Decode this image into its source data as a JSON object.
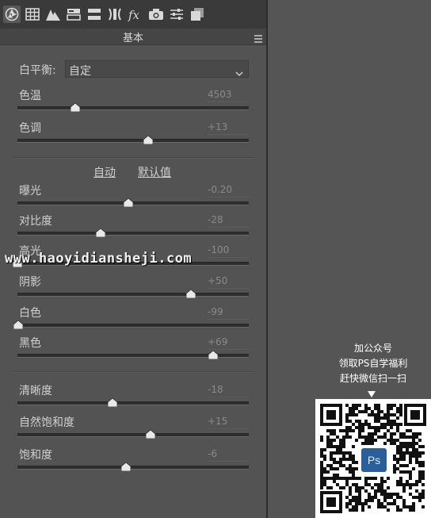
{
  "toolbar": {
    "icons": [
      "aperture-icon",
      "grid-icon",
      "mountain-icon",
      "split-tone-icon",
      "hsl-bars-icon",
      "lens-icon",
      "fx-icon",
      "camera-icon",
      "sliders-icon",
      "layers-icon"
    ]
  },
  "section": {
    "title": "基本"
  },
  "white_balance": {
    "label": "白平衡:",
    "value": "自定"
  },
  "temp_tint": [
    {
      "id": "temperature",
      "label": "色温",
      "value": "4503",
      "level": 0.25
    },
    {
      "id": "tint",
      "label": "色调",
      "value": "+13",
      "level": 0.565
    }
  ],
  "links": {
    "auto": "自动",
    "default": "默认值"
  },
  "tone": [
    {
      "id": "exposure",
      "label": "曝光",
      "value": "-0.20",
      "level": 0.48
    },
    {
      "id": "contrast",
      "label": "对比度",
      "value": "-28",
      "level": 0.36
    },
    {
      "id": "highlights",
      "label": "高光",
      "value": "-100",
      "level": 0.0
    },
    {
      "id": "shadows",
      "label": "阴影",
      "value": "+50",
      "level": 0.75
    },
    {
      "id": "whites",
      "label": "白色",
      "value": "-99",
      "level": 0.005
    },
    {
      "id": "blacks",
      "label": "黑色",
      "value": "+69",
      "level": 0.845
    }
  ],
  "presence": [
    {
      "id": "clarity",
      "label": "清晰度",
      "value": "-18",
      "level": 0.41
    },
    {
      "id": "vibrance",
      "label": "自然饱和度",
      "value": "+15",
      "level": 0.575
    },
    {
      "id": "saturation",
      "label": "饱和度",
      "value": "-6",
      "level": 0.47
    }
  ],
  "watermark": "www.haoyidiansheji.com",
  "promo": {
    "line1": "加公众号",
    "line2": "领取PS自学福利",
    "line3": "赶快微信扫一扫",
    "badge": "Ps"
  },
  "colors": {
    "panel_bg": "#535353",
    "toolbar_bg": "#3a3a3a",
    "track": "#2e2e2e",
    "thumb": "#e8e8e8"
  }
}
